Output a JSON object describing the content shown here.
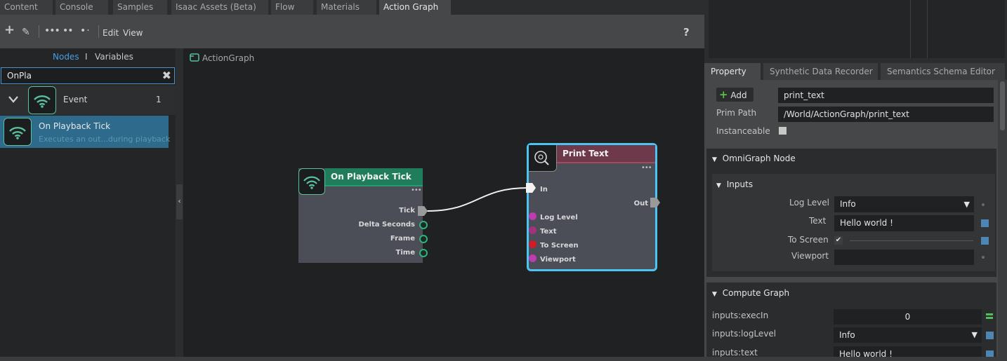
{
  "tabs": [
    "Content",
    "Console",
    "Samples",
    "Isaac Assets (Beta)",
    "Flow",
    "Materials",
    "Action Graph"
  ],
  "toolbar": {
    "edit_label": "Edit",
    "view_label": "View",
    "help_label": "?"
  },
  "left_panel": {
    "tab_nodes": "Nodes",
    "tab_sep": "I",
    "tab_variables": "Variables",
    "search_value": "OnPla",
    "category": {
      "label": "Event",
      "count": "1"
    },
    "item": {
      "title": "On Playback Tick",
      "description": "Executes an out...during playback"
    }
  },
  "graph": {
    "breadcrumb": "ActionGraph",
    "node1": {
      "title": "On Playback Tick",
      "pins": [
        "Tick",
        "Delta Seconds",
        "Frame",
        "Time"
      ],
      "header_color": "#1f7d5c"
    },
    "node2": {
      "title": "Print Text",
      "input_exec": "In",
      "output_exec": "Out",
      "pins": [
        "Log Level",
        "Text",
        "To Screen",
        "Viewport"
      ],
      "header_color": "#6e3a4b",
      "border_color": "#4cc3f0"
    }
  },
  "right_panel": {
    "tabs": [
      "Property",
      "Synthetic Data Recorder",
      "Semantics Schema Editor"
    ],
    "add_label": "Add",
    "name_value": "print_text",
    "prim_path_label": "Prim Path",
    "prim_path_value": "/World/ActionGraph/print_text",
    "instanceable_label": "Instanceable",
    "omnigraph_section": "OmniGraph Node",
    "inputs_section": "Inputs",
    "log_level_label": "Log Level",
    "log_level_value": "Info",
    "text_label": "Text",
    "text_value": "Hello world !",
    "to_screen_label": "To Screen",
    "viewport_label": "Viewport",
    "compute_section": "Compute Graph",
    "exec_in_label": "inputs:execIn",
    "exec_in_value": "0",
    "loglevel_label": "inputs:logLevel",
    "loglevel_value": "Info",
    "inputs_text_label": "inputs:text",
    "inputs_text_value": "Hello world !"
  },
  "colors": {
    "accent_blue": "#4a8fd0",
    "selection": "#2d6a8b",
    "event_green": "#5bc09c",
    "pin_green": "#2bb57e",
    "pin_magenta": "#c03ab0",
    "pin_purple": "#a0327e",
    "pin_red": "#d01c24"
  },
  "icons": [
    "plus-icon",
    "pencil-icon",
    "dots-icon",
    "close-icon",
    "chevron-down-icon",
    "wifi-signal-icon",
    "graph-icon",
    "search-bug-icon",
    "dropdown-arrow-icon",
    "checkmark-icon",
    "triangle-down-icon"
  ]
}
